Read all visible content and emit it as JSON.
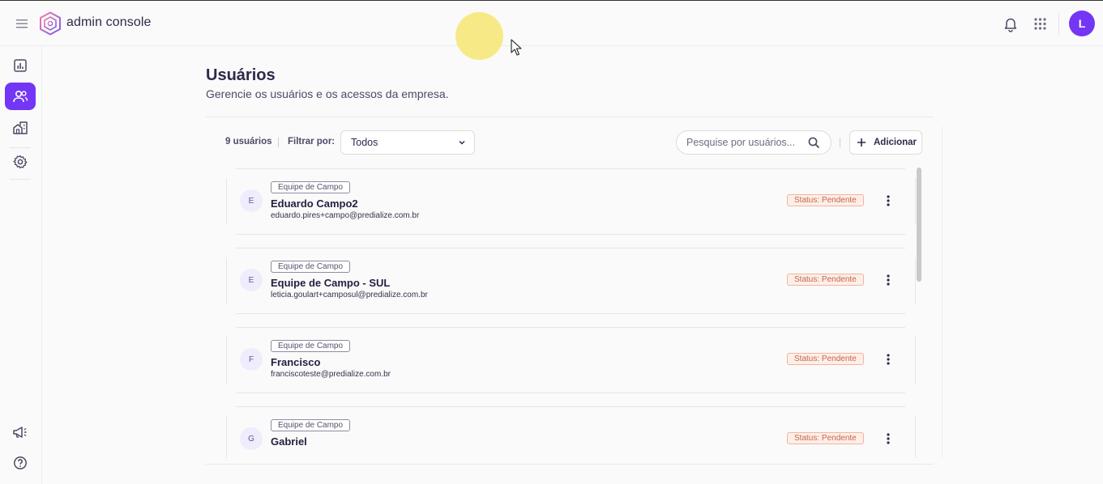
{
  "topbar": {
    "brand": "admin console",
    "avatar_letter": "L"
  },
  "sidebar": {
    "items": [
      {
        "name": "dashboard",
        "icon": "chart-icon",
        "active": false
      },
      {
        "name": "users",
        "icon": "users-icon",
        "active": true
      },
      {
        "name": "buildings",
        "icon": "buildings-icon",
        "active": false
      },
      {
        "name": "settings",
        "icon": "gear-icon",
        "active": false
      }
    ],
    "bottom_items": [
      {
        "name": "announcements",
        "icon": "megaphone-icon"
      },
      {
        "name": "help",
        "icon": "help-icon"
      }
    ]
  },
  "page": {
    "title": "Usuários",
    "subtitle": "Gerencie os usuários e os acessos da empresa."
  },
  "toolbar": {
    "count": "9 usuários",
    "filter_label": "Filtrar por:",
    "filter_value": "Todos",
    "search_placeholder": "Pesquise por usuários...",
    "add_label": "Adicionar"
  },
  "users": [
    {
      "initial": "E",
      "team": "Equipe de Campo",
      "name": "Eduardo Campo2",
      "email": "eduardo.pires+campo@predialize.com.br",
      "status": "Status: Pendente"
    },
    {
      "initial": "E",
      "team": "Equipe de Campo",
      "name": "Equipe de Campo - SUL",
      "email": "leticia.goulart+camposul@predialize.com.br",
      "status": "Status: Pendente"
    },
    {
      "initial": "F",
      "team": "Equipe de Campo",
      "name": "Francisco",
      "email": "franciscoteste@predialize.com.br",
      "status": "Status: Pendente"
    },
    {
      "initial": "G",
      "team": "Equipe de Campo",
      "name": "Gabriel",
      "email": "",
      "status": "Status: Pendente"
    }
  ],
  "colors": {
    "accent": "#7436f5",
    "status_text": "#c8654a",
    "status_bg": "#fdeee8",
    "status_border": "#f3b59b"
  }
}
